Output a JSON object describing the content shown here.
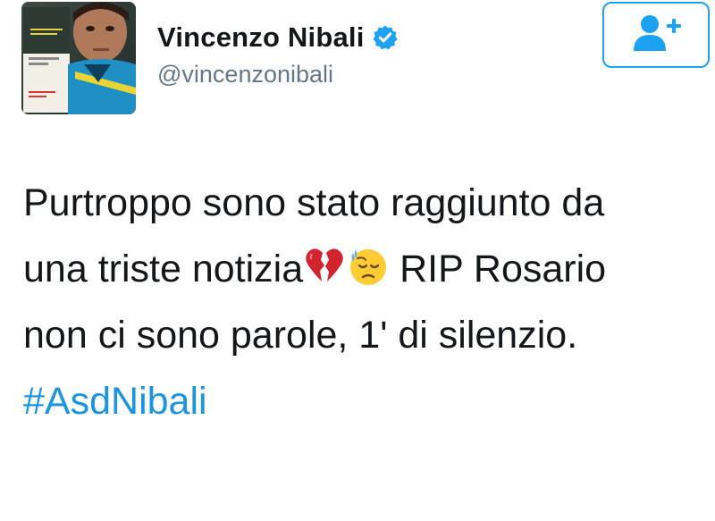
{
  "profile": {
    "display_name": "Vincenzo Nibali",
    "handle": "@vincenzonibali",
    "verified": true,
    "avatar_icon": "profile-photo"
  },
  "follow_button": {
    "icon": "add-user-icon",
    "color": "#1da1f2"
  },
  "tweet": {
    "line1": "Purtroppo sono stato raggiunto da",
    "line2_text": "una triste notizia",
    "line2_emoji1": "broken-heart-emoji",
    "line2_emoji2": "downcast-face-with-sweat-emoji",
    "line2_rest": " RIP Rosario",
    "line3": "non ci sono parole, 1' di silenzio.",
    "hashtag": "#AsdNibali"
  },
  "colors": {
    "text": "#14171a",
    "secondary": "#657786",
    "link": "#1b95e0",
    "verified_badge": "#1da1f2"
  }
}
